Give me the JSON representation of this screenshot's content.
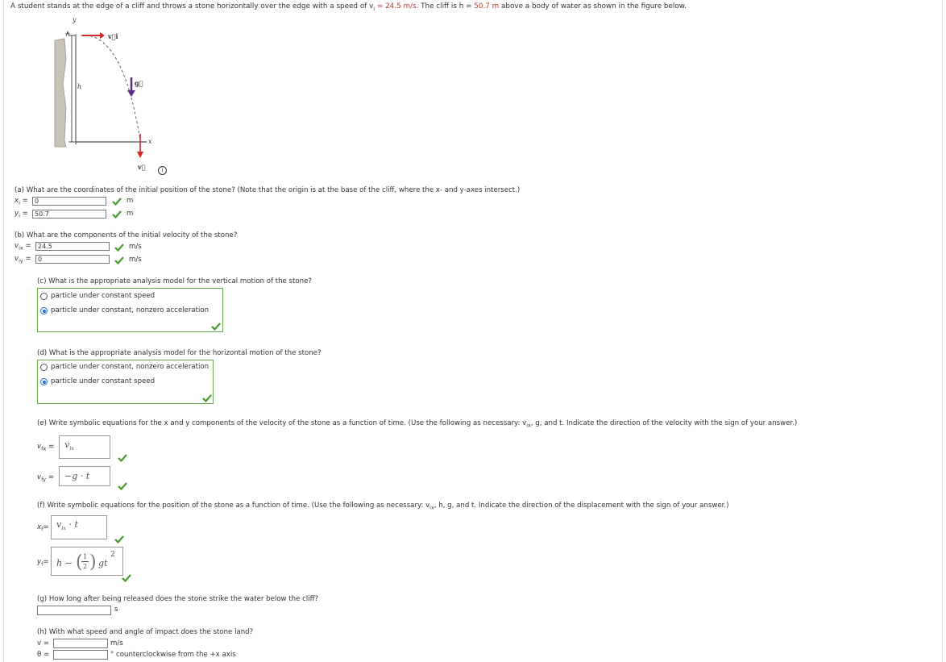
{
  "problem": {
    "part1": "A student stands at the edge of a cliff and throws a stone horizontally over the edge with a speed of v",
    "vi_sub": "i",
    "vi_val": " = 24.5 m/s.",
    "part2": " The cliff is h = ",
    "h_val": "50.7 m",
    "part3": " above a body of water as shown in the figure below."
  },
  "figure": {
    "y_label": "y",
    "x_label": "x",
    "h_label": "h",
    "vi_label": "v⃗i",
    "g_label": "g⃗",
    "v_label": "v⃗",
    "info_icon": "i"
  },
  "part_a": {
    "question": "(a) What are the coordinates of the initial position of the stone? (Note that the origin is at the base of the cliff, where the x- and y-axes intersect.)",
    "xi_label": "x",
    "xi_sub": "i",
    "xi_value": "0",
    "yi_label": "y",
    "yi_sub": "i",
    "yi_value": "50.7",
    "unit": "m"
  },
  "part_b": {
    "question": "(b) What are the components of the initial velocity of the stone?",
    "vix_label": "v",
    "vix_sub": "ix",
    "vix_value": "24.5",
    "viy_label": "v",
    "viy_sub": "iy",
    "viy_value": "0",
    "unit": "m/s"
  },
  "part_c": {
    "question": "(c) What is the appropriate analysis model for the vertical motion of the stone?",
    "options": [
      "particle under constant speed",
      "particle under constant, nonzero acceleration"
    ],
    "selected": 1
  },
  "part_d": {
    "question": "(d) What is the appropriate analysis model for the horizontal motion of the stone?",
    "options": [
      "particle under constant, nonzero acceleration",
      "particle under constant speed"
    ],
    "selected": 1
  },
  "part_e": {
    "question_a": "(e) Write symbolic equations for the x and y components of the velocity of the stone as a function of time. (Use the following as necessary: v",
    "question_sub": "ix",
    "question_b": ", g, and t. Indicate the direction of the velocity with the sign of your answer.)",
    "vfx_label": "v",
    "vfx_sub": "fx",
    "vfx_expr": "v",
    "vfx_expr_sub": "ix",
    "vfy_label": "v",
    "vfy_sub": "fy",
    "vfy_expr": "−g · t"
  },
  "part_f": {
    "question_a": "(f) Write symbolic equations for the position of the stone as a function of time. (Use the following as necessary: v",
    "question_sub": "ix",
    "question_b": ", h, g, and t. Indicate the direction of the displacement with the sign of your answer.)",
    "xf_label": "x",
    "xf_sub": "f",
    "xf_expr": "v",
    "xf_expr_sub": "ix",
    "xf_expr_tail": " · t",
    "yf_label": "y",
    "yf_sub": "f",
    "yf_expr_h": "h −",
    "yf_frac_num": "1",
    "yf_frac_den": "2",
    "yf_expr_tail": "gt",
    "yf_exp": "2"
  },
  "part_g": {
    "question": "(g) How long after being released does the stone strike the water below the cliff?",
    "value": "",
    "unit": "s"
  },
  "part_h": {
    "question": "(h) With what speed and angle of impact does the stone land?",
    "v_label": "v =",
    "v_value": "",
    "v_unit": "m/s",
    "theta_label": "θ =",
    "theta_value": "",
    "theta_unit": "° counterclockwise from the +x axis"
  },
  "colors": {
    "correct": "#4a9a2a",
    "radio_selected": "#1e6fd0",
    "arrow_red": "#d62728",
    "arrow_purple": "#5b2c83"
  }
}
